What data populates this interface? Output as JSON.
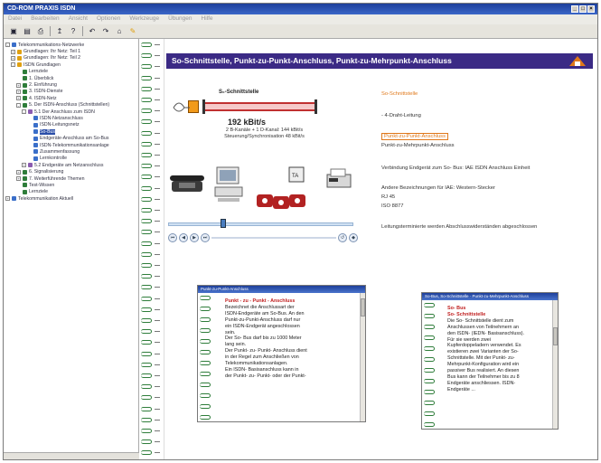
{
  "window": {
    "title": "CD-ROM PRAXIS ISDN"
  },
  "menu": [
    "Datei",
    "Bearbeiten",
    "Ansicht",
    "Optionen",
    "Werkzeuge",
    "Übungen",
    "Hilfe"
  ],
  "toolbar": {
    "buttons": [
      "open-icon",
      "save-icon",
      "print-icon",
      "forward-icon",
      "help-icon",
      "undo-icon",
      "redo-icon",
      "home-icon",
      "highlight-icon"
    ]
  },
  "tree": {
    "items": [
      {
        "label": "Telekommunikations-Netzwerke",
        "level": 0,
        "node": "-"
      },
      {
        "label": "Grundlagen: Ihr Netz: Teil 1",
        "level": 1,
        "node": "+"
      },
      {
        "label": "Grundlagen: Ihr Netz: Teil 2",
        "level": 1,
        "node": "+"
      },
      {
        "label": "ISDN Grundlagen",
        "level": 1,
        "node": "-"
      },
      {
        "label": "Lernziele",
        "level": 2,
        "node": ""
      },
      {
        "label": "1. Überblick",
        "level": 2,
        "node": ""
      },
      {
        "label": "2. Einführung",
        "level": 2,
        "node": "+"
      },
      {
        "label": "3. ISDN-Dienste",
        "level": 2,
        "node": "+"
      },
      {
        "label": "4. ISDN-Netz",
        "level": 2,
        "node": "+"
      },
      {
        "label": "5. Der ISDN-Anschluss (Schnittstellen)",
        "level": 2,
        "node": "-"
      },
      {
        "label": "5.1 Der Anschluss zum ISDN",
        "level": 3,
        "node": "-"
      },
      {
        "label": "ISDN-Netzanschluss",
        "level": 4,
        "node": ""
      },
      {
        "label": "ISDN-Leitungsnetz",
        "level": 4,
        "node": ""
      },
      {
        "label": "So-Bus",
        "level": 4,
        "node": "",
        "selected": true
      },
      {
        "label": "Endgeräte-Anschluss am So-Bus",
        "level": 4,
        "node": ""
      },
      {
        "label": "ISDN-Telekommunikationsanlage",
        "level": 4,
        "node": ""
      },
      {
        "label": "Zusammenfassung",
        "level": 4,
        "node": ""
      },
      {
        "label": "Lernkontrolle",
        "level": 4,
        "node": ""
      },
      {
        "label": "5.2 Endgeräte am Netzanschluss",
        "level": 3,
        "node": "+"
      },
      {
        "label": "6. Signalisierung",
        "level": 2,
        "node": "+"
      },
      {
        "label": "7. Weiterführende Themen",
        "level": 2,
        "node": "+"
      },
      {
        "label": "Test-Wissen",
        "level": 2,
        "node": ""
      },
      {
        "label": "Lernziele",
        "level": 2,
        "node": ""
      },
      {
        "label": "Telekommunikation Aktuell",
        "level": 0,
        "node": "+"
      }
    ]
  },
  "page": {
    "heading": "So-Schnittstelle, Punkt-zu-Punkt-Anschluss, Punkt-zu-Mehrpunkt-Anschluss",
    "diagram": {
      "title": "S₀-Schnittstelle",
      "speed": "192 kBit/s",
      "line1": "2 B-Kanäle + 1 D-Kanal: 144 kBit/s",
      "line2": "Steuerung/Synchronisation 48 kBit/s"
    },
    "right_links": [
      {
        "text": "So-Schnittstelle",
        "style": "orange"
      },
      {
        "text": "- 4-Draht-Leitung",
        "style": "plain"
      },
      {
        "text": "Punkt-zu-Punkt-Anschluss",
        "style": "boxed"
      },
      {
        "text": "Punkt-zu-Mehrpunkt-Anschluss",
        "style": "plain"
      },
      {
        "text": "Verbindung Endgerät zum So- Bus: IAE ISDN Anschluss Einheit",
        "style": "plain"
      },
      {
        "text": "Andere Bezeichnungen für IAE: Western-Stecker",
        "style": "plain"
      },
      {
        "text": "RJ 45",
        "style": "plain"
      },
      {
        "text": "ISO 8877",
        "style": "plain"
      },
      {
        "text": "Leitungsterminierte werden Abschlusswiderständen abgeschlossen",
        "style": "plain"
      }
    ],
    "nav_buttons": [
      "⏮",
      "◀",
      "▶",
      "⏭",
      "↺",
      "◆"
    ]
  },
  "popup_left": {
    "title": "Punkt-zu-Punkt-Anschluss",
    "heading": "Punkt - zu - Punkt - Anschluss",
    "lines": [
      "Bezeichnet die Anschlussart der",
      "ISDN-Endgeräte am So-Bus. An den",
      "Punkt-zu-Punkt-Anschluss darf nur",
      "ein ISDN-Endgerät angeschlossen",
      "sein.",
      "Der So- Bus darf bis zu 1000 Meter",
      "lang sein.",
      "Der Punkt- zu- Punkt- Anschluss dient",
      "in der Regel zum Anschließen von",
      "Telekommunikationsanlagen.",
      "Ein ISDN- Basisanschluss kann in",
      "der Punkt- zu- Punkt- oder der Punkt-"
    ]
  },
  "popup_right": {
    "title": "So-Bus, So-Schnittstelle · Punkt-zu-Mehrpunkt-Anschluss",
    "heading1": "So- Bus",
    "heading2": "So- Schnittstelle",
    "lines": [
      "Die So- Schnittstelle dient zum",
      "Anschlussen von Teilnehmern an",
      "den ISDN- (IEDN- Basisanschluss).",
      "Für sie werden zwei",
      "Kupferdoppeladern verwendet. Es",
      "existieren zwei Varianten der So-",
      "Schnittstelle. Mit der Punkt- zu-",
      "Mehrpunkt-Konfiguration wird ein",
      "passiver Bus realisiert. An diesen",
      "Bus kann der Teilnehmer bis zu 8",
      "Endgeräte anschliessen. ISDN-",
      "Endgeräte ..."
    ]
  },
  "colors": {
    "title_bar": "#1d3f9a",
    "heading_bar": "#3b2a85",
    "accent_orange": "#e0781a",
    "ring_green": "#2e7d3a",
    "link_red": "#c02020"
  }
}
